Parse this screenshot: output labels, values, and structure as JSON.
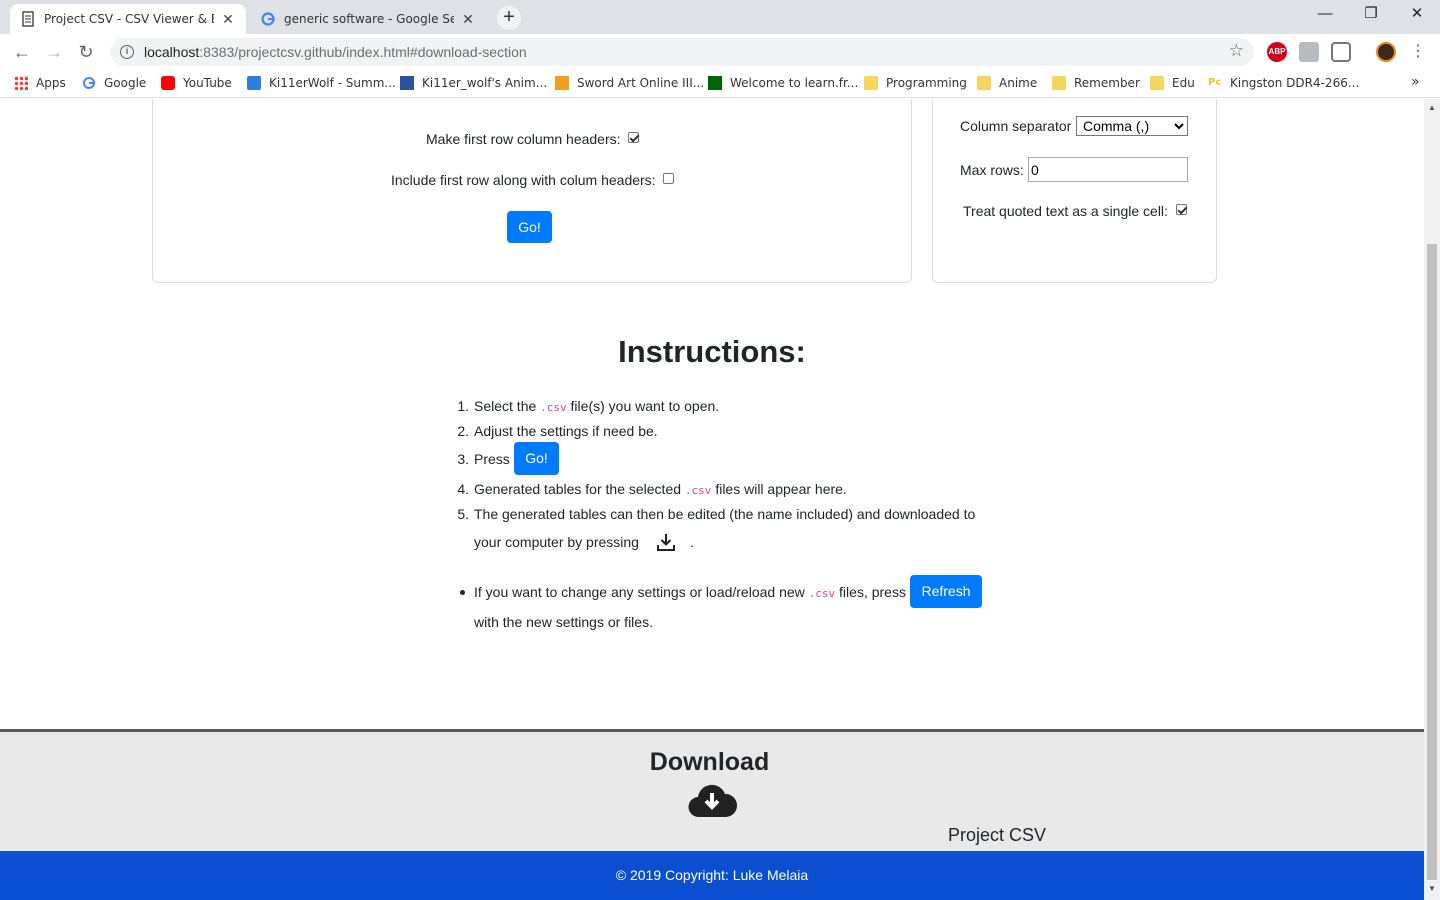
{
  "browser": {
    "tabs": [
      {
        "title": "Project CSV - CSV Viewer & Editor",
        "active": true
      },
      {
        "title": "generic software - Google Search",
        "active": false
      }
    ],
    "new_tab": "+",
    "window_controls": {
      "minimize": "—",
      "maximize": "❐",
      "close": "✕"
    },
    "url_host": "localhost",
    "url_rest": ":8383/projectcsv.github/index.html#download-section",
    "bookmarks": [
      {
        "label": "Apps"
      },
      {
        "label": "Google"
      },
      {
        "label": "YouTube"
      },
      {
        "label": "Ki11erWolf - Summ..."
      },
      {
        "label": "Ki11er_wolf's Anim..."
      },
      {
        "label": "Sword Art Online III..."
      },
      {
        "label": "Welcome to learn.fr..."
      },
      {
        "label": "Programming"
      },
      {
        "label": "Anime"
      },
      {
        "label": "Remember"
      },
      {
        "label": "Edu"
      },
      {
        "label": "Kingston DDR4-266..."
      }
    ],
    "bookmarks_overflow": "»",
    "extension_abp": "ABP"
  },
  "options": {
    "first_row_headers_label": "Make first row column headers:",
    "first_row_headers_checked": true,
    "include_first_row_label": "Include first row along with colum headers:",
    "include_first_row_checked": false,
    "go_button": "Go!"
  },
  "settings": {
    "column_separator_label": "Column separator",
    "column_separator_value": "Comma (,)",
    "max_rows_label": "Max rows:",
    "max_rows_value": "0",
    "quoted_text_label": "Treat quoted text as a single cell:",
    "quoted_text_checked": true
  },
  "instructions": {
    "heading": "Instructions:",
    "steps": [
      {
        "num": "1.",
        "before": "Select the",
        "code": ".csv",
        "after": "file(s) you want to open."
      },
      {
        "num": "2.",
        "text": "Adjust the settings if need be."
      },
      {
        "num": "3.",
        "before": "Press",
        "button": "Go!"
      },
      {
        "num": "4.",
        "before": "Generated tables for the selected",
        "code": ".csv",
        "after": "files will appear here."
      },
      {
        "num": "5.",
        "line1": "The generated tables can then be edited (the name included) and downloaded to",
        "line2": "your computer by pressing",
        "line2_end": "."
      }
    ],
    "note": {
      "before": "If you want to change any settings or load/reload new",
      "code": ".csv",
      "after": "files, press",
      "button": "Refresh",
      "line2": "with the new settings or files."
    }
  },
  "download": {
    "heading": "Download",
    "brand": "Project CSV"
  },
  "footer": {
    "copyright": "© 2019 Copyright: Luke Melaia"
  }
}
